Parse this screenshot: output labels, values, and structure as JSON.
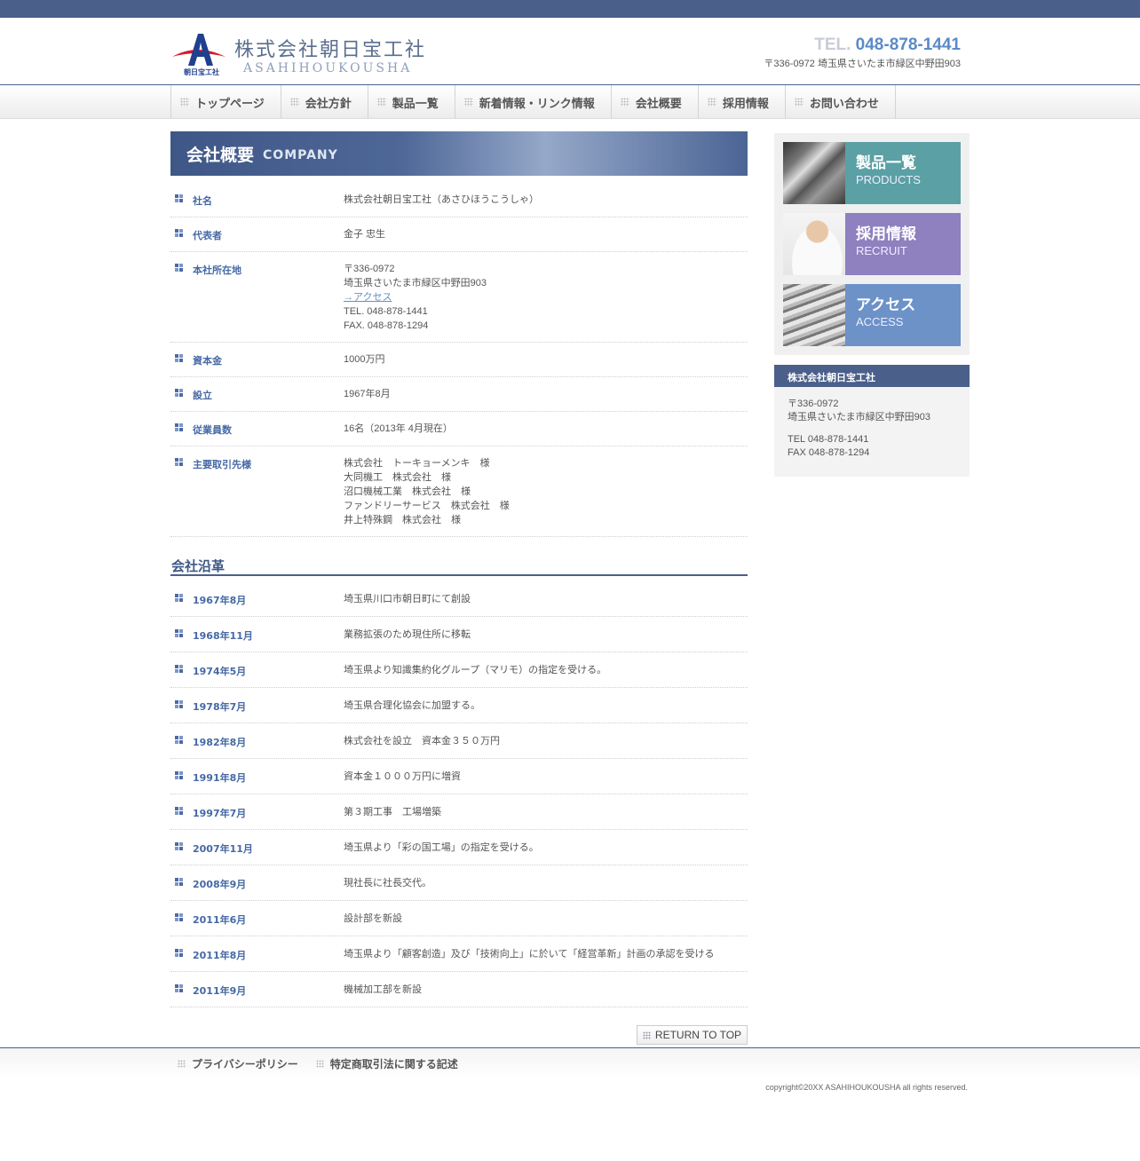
{
  "header": {
    "logo_name": "株式会社朝日宝工社",
    "logo_roman": "ASAHIHOUKOUSHA",
    "logo_badge": "朝日宝工社",
    "tel_label": "TEL.",
    "tel_number": "048-878-1441",
    "address": "〒336-0972 埼玉県さいたま市緑区中野田903"
  },
  "nav": [
    {
      "label": "トップページ"
    },
    {
      "label": "会社方針"
    },
    {
      "label": "製品一覧"
    },
    {
      "label": "新着情報・リンク情報"
    },
    {
      "label": "会社概要"
    },
    {
      "label": "採用情報"
    },
    {
      "label": "お問い合わせ"
    }
  ],
  "page_head": {
    "jp": "会社概要",
    "en": "COMPANY"
  },
  "company_info": [
    {
      "key": "社名",
      "lines": [
        "株式会社朝日宝工社（あさひほうこうしゃ）"
      ]
    },
    {
      "key": "代表者",
      "lines": [
        "金子 忠生"
      ]
    },
    {
      "key": "本社所在地",
      "lines": [
        "〒336-0972",
        "埼玉県さいたま市緑区中野田903"
      ],
      "link": "→アクセス",
      "after": [
        "TEL. 048-878-1441",
        "FAX. 048-878-1294"
      ]
    },
    {
      "key": "資本金",
      "lines": [
        "1000万円"
      ]
    },
    {
      "key": "設立",
      "lines": [
        "1967年8月"
      ]
    },
    {
      "key": "従業員数",
      "lines": [
        "16名（2013年 4月現在）"
      ]
    },
    {
      "key": "主要取引先様",
      "lines": [
        "株式会社　トーキョーメンキ　様",
        "大同機工　株式会社　様",
        "沼口機械工業　株式会社　様",
        "ファンドリーサービス　株式会社　様",
        "井上特殊鋼　株式会社　様"
      ]
    }
  ],
  "history_title": "会社沿革",
  "history": [
    {
      "date": "1967年8月",
      "event": "埼玉県川口市朝日町にて創設"
    },
    {
      "date": "1968年11月",
      "event": "業務拡張のため現住所に移転"
    },
    {
      "date": "1974年5月",
      "event": "埼玉県より知識集約化グループ（マリモ）の指定を受ける。"
    },
    {
      "date": "1978年7月",
      "event": "埼玉県合理化協会に加盟する。"
    },
    {
      "date": "1982年8月",
      "event": "株式会社を設立　資本金３５０万円"
    },
    {
      "date": "1991年8月",
      "event": "資本金１０００万円に増資"
    },
    {
      "date": "1997年7月",
      "event": "第３期工事　工場増築"
    },
    {
      "date": "2007年11月",
      "event": "埼玉県より「彩の国工場」の指定を受ける。"
    },
    {
      "date": "2008年9月",
      "event": "現社長に社長交代。"
    },
    {
      "date": "2011年6月",
      "event": "設計部を新設"
    },
    {
      "date": "2011年8月",
      "event": "埼玉県より「顧客創造」及び「技術向上」に於いて「経営革新」計画の承認を受ける"
    },
    {
      "date": "2011年9月",
      "event": "機械加工部を新設"
    }
  ],
  "return_top": "RETURN TO TOP",
  "sidebar": {
    "banners": [
      {
        "jp": "製品一覧",
        "en": "PRODUCTS"
      },
      {
        "jp": "採用情報",
        "en": "RECRUIT"
      },
      {
        "jp": "アクセス",
        "en": "ACCESS"
      }
    ],
    "company_title": "株式会社朝日宝工社",
    "postal": "〒336-0972",
    "address": "埼玉県さいたま市緑区中野田903",
    "tel": "TEL 048-878-1441",
    "fax": "FAX 048-878-1294"
  },
  "footer": {
    "links": [
      {
        "label": "プライバシーポリシー"
      },
      {
        "label": "特定商取引法に関する記述"
      }
    ],
    "copyright": "copyright©20XX ASAHIHOUKOUSHA all rights reserved."
  },
  "colors": {
    "brand": "#4a5f8a",
    "accent": "#5a8ac8",
    "products": "#5aa0a4",
    "recruit": "#8f80bf",
    "access": "#6c92c8"
  }
}
